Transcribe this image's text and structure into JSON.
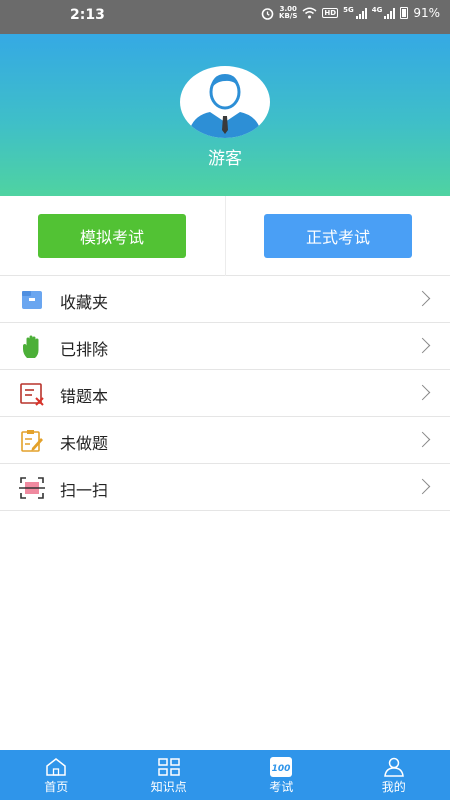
{
  "status_bar": {
    "time": "2:13",
    "speed_value": "3.00",
    "speed_unit": "KB/S",
    "hd_label": "HD",
    "net_5g": "5G",
    "net_4g": "4G",
    "battery": "91%"
  },
  "profile": {
    "username": "游客",
    "icon": "user-avatar-icon"
  },
  "exam": {
    "mock_label": "模拟考试",
    "mock_color": "#52c234",
    "formal_label": "正式考试",
    "formal_color": "#4a9ff5"
  },
  "menu": {
    "items": [
      {
        "label": "收藏夹",
        "icon": "folder-icon"
      },
      {
        "label": "已排除",
        "icon": "hand-icon"
      },
      {
        "label": "错题本",
        "icon": "wrong-book-icon"
      },
      {
        "label": "未做题",
        "icon": "edit-note-icon"
      },
      {
        "label": "扫一扫",
        "icon": "scan-icon"
      }
    ]
  },
  "tabs": [
    {
      "label": "首页",
      "icon": "home-icon"
    },
    {
      "label": "知识点",
      "icon": "grid-icon"
    },
    {
      "label": "考试",
      "icon": "exam-100-icon",
      "badge": "100",
      "active": true
    },
    {
      "label": "我的",
      "icon": "user-icon"
    }
  ],
  "colors": {
    "primary": "#2f95ea",
    "header_top": "#35a9e4",
    "header_bottom": "#4fd3a1"
  }
}
